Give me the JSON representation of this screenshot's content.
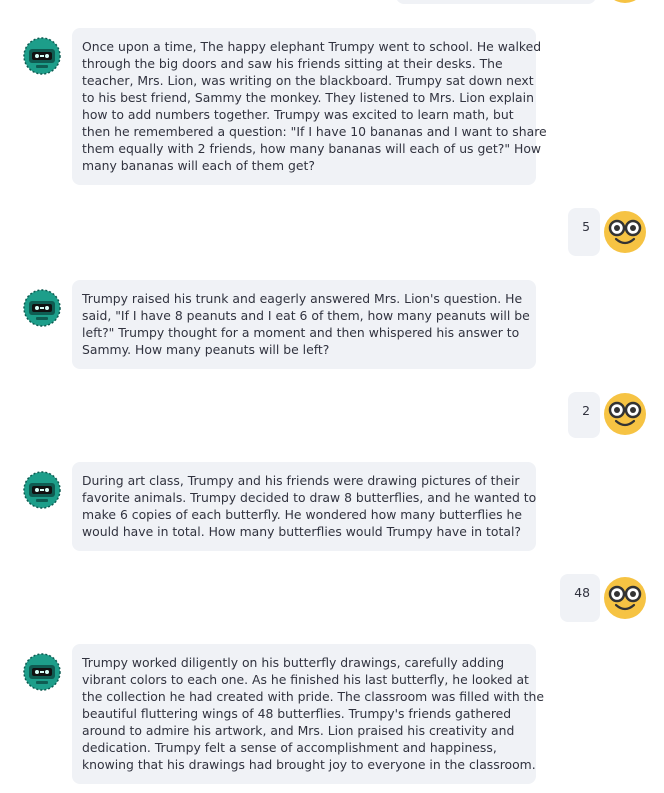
{
  "messages": [
    {
      "role": "assistant",
      "lines": [
        "Once upon a time, The happy elephant Trumpy went to school. He walked",
        "through the big doors and saw his friends sitting at their desks. The",
        "teacher, Mrs. Lion, was writing on the blackboard. Trumpy sat down next",
        "to his best friend, Sammy the monkey. They listened to Mrs. Lion explain",
        "how to add numbers together. Trumpy was excited to learn math, but",
        "then he remembered a question: \"If I have 10 bananas and I want to share",
        "them equally with 2 friends, how many bananas will each of us get?\" How",
        "many bananas will each of them get?"
      ]
    },
    {
      "role": "user",
      "text": "5"
    },
    {
      "role": "assistant",
      "lines": [
        "Trumpy raised his trunk and eagerly answered Mrs. Lion's question. He",
        "said, \"If I have 8 peanuts and I eat 6 of them, how many peanuts will be",
        "left?\" Trumpy thought for a moment and then whispered his answer to",
        "Sammy. How many peanuts will be left?"
      ]
    },
    {
      "role": "user",
      "text": "2"
    },
    {
      "role": "assistant",
      "lines": [
        "During art class, Trumpy and his friends were drawing pictures of their",
        "favorite animals. Trumpy decided to draw 8 butterflies, and he wanted to",
        "make 6 copies of each butterfly. He wondered how many butterflies he",
        "would have in total. How many butterflies would Trumpy have in total?"
      ]
    },
    {
      "role": "user",
      "text": "48"
    },
    {
      "role": "assistant",
      "lines": [
        "Trumpy worked diligently on his butterfly drawings, carefully adding",
        "vibrant colors to each one. As he finished his last butterfly, he looked at",
        "the collection he had created with pride. The classroom was filled with the",
        "beautiful fluttering wings of 48 butterflies. Trumpy's friends gathered",
        "around to admire his artwork, and Mrs. Lion praised his creativity and",
        "dedication. Trumpy felt a sense of accomplishment and happiness,",
        "knowing that his drawings had brought joy to everyone in the classroom."
      ]
    }
  ],
  "icons": {
    "assistant_avatar": "robot-icon",
    "user_avatar": "nerd-face-icon"
  },
  "colors": {
    "bubble_bg": "#f0f2f6",
    "text": "#31333f",
    "robot": "#1d9e8a",
    "robot_dark": "#0f5c52",
    "user_face": "#f6c343"
  }
}
